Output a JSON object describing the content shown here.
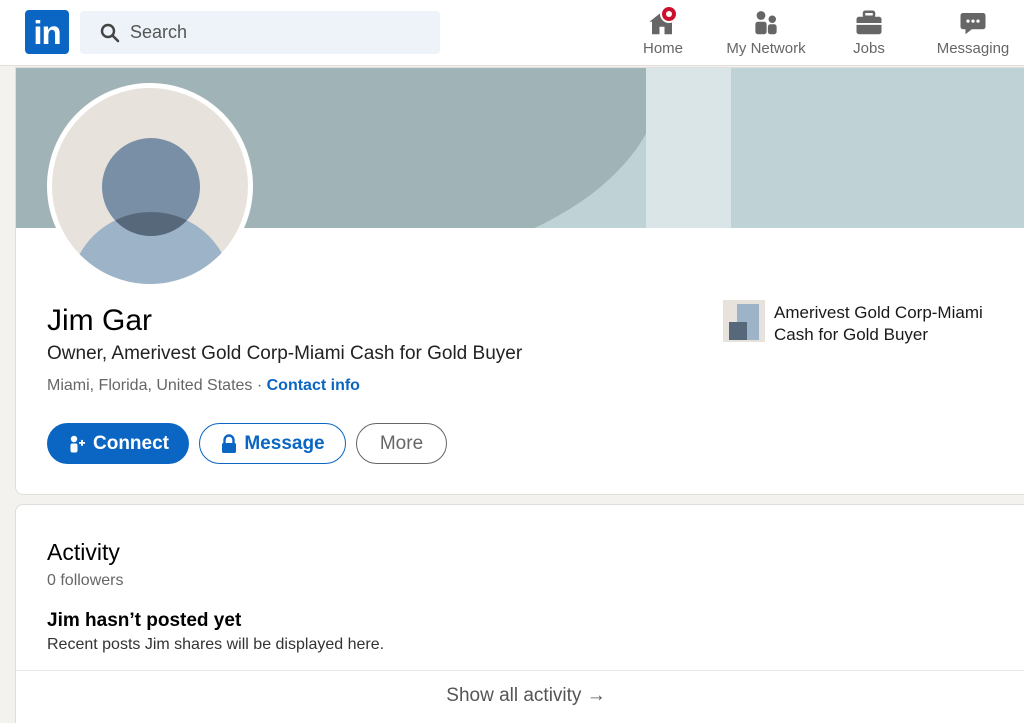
{
  "nav": {
    "logo_text": "in",
    "search_placeholder": "Search",
    "items": [
      {
        "label": "Home",
        "icon": "home-icon"
      },
      {
        "label": "My Network",
        "icon": "people-icon"
      },
      {
        "label": "Jobs",
        "icon": "briefcase-icon"
      },
      {
        "label": "Messaging",
        "icon": "chat-icon"
      }
    ],
    "notification_color": "#cb112d"
  },
  "profile": {
    "name": "Jim Gar",
    "headline": "Owner, Amerivest Gold Corp-Miami Cash for Gold Buyer",
    "location": "Miami, Florida, United States",
    "separator": " · ",
    "contact_label": "Contact info",
    "company": "Amerivest Gold Corp-Miami Cash for Gold Buyer",
    "buttons": {
      "connect": "Connect",
      "message": "Message",
      "more": "More"
    },
    "accent": "#0a66c2"
  },
  "activity": {
    "title": "Activity",
    "followers": "0 followers",
    "empty_title": "Jim hasn’t posted yet",
    "empty_body": "Recent posts Jim shares will be displayed here.",
    "show_all": "Show all activity →"
  }
}
